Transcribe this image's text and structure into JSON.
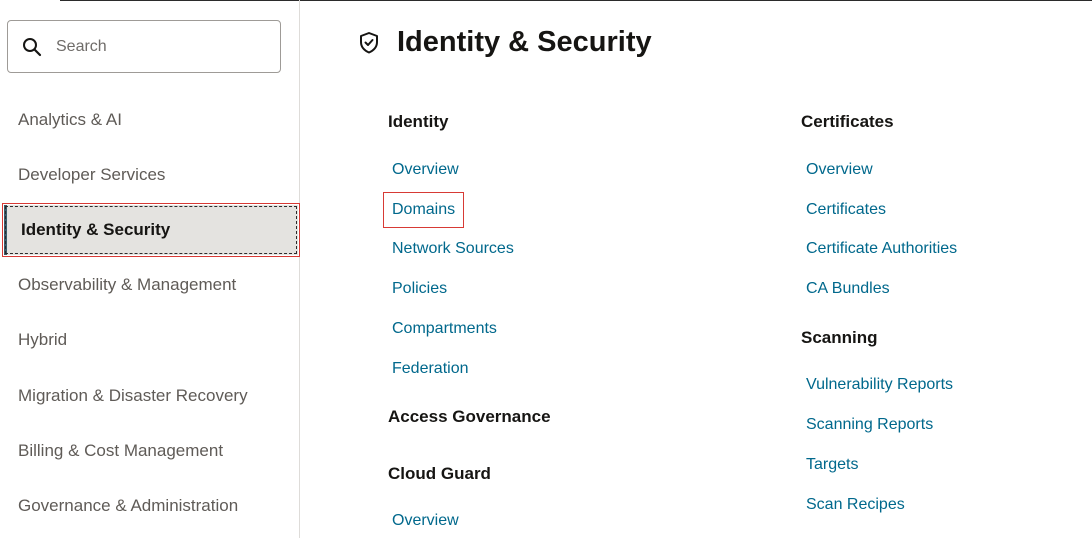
{
  "search": {
    "placeholder": "Search"
  },
  "sidebar": {
    "items": [
      {
        "label": "Analytics & AI"
      },
      {
        "label": "Developer Services"
      },
      {
        "label": "Identity & Security"
      },
      {
        "label": "Observability & Management"
      },
      {
        "label": "Hybrid"
      },
      {
        "label": "Migration & Disaster Recovery"
      },
      {
        "label": "Billing & Cost Management"
      },
      {
        "label": "Governance & Administration"
      }
    ],
    "selected": "Identity & Security"
  },
  "header": {
    "title": "Identity & Security",
    "icon": "shield-check-icon"
  },
  "left_column": {
    "identity": {
      "title": "Identity",
      "links": [
        "Overview",
        "Domains",
        "Network Sources",
        "Policies",
        "Compartments",
        "Federation"
      ]
    },
    "access_governance": {
      "title": "Access Governance"
    },
    "cloud_guard": {
      "title": "Cloud Guard",
      "links": [
        "Overview"
      ]
    }
  },
  "right_column": {
    "certificates": {
      "title": "Certificates",
      "links": [
        "Overview",
        "Certificates",
        "Certificate Authorities",
        "CA Bundles"
      ]
    },
    "scanning": {
      "title": "Scanning",
      "links": [
        "Vulnerability Reports",
        "Scanning Reports",
        "Targets",
        "Scan Recipes"
      ]
    }
  },
  "colors": {
    "link": "#00688c",
    "highlight": "#d73a35",
    "active_bg": "#e4e3e0"
  }
}
